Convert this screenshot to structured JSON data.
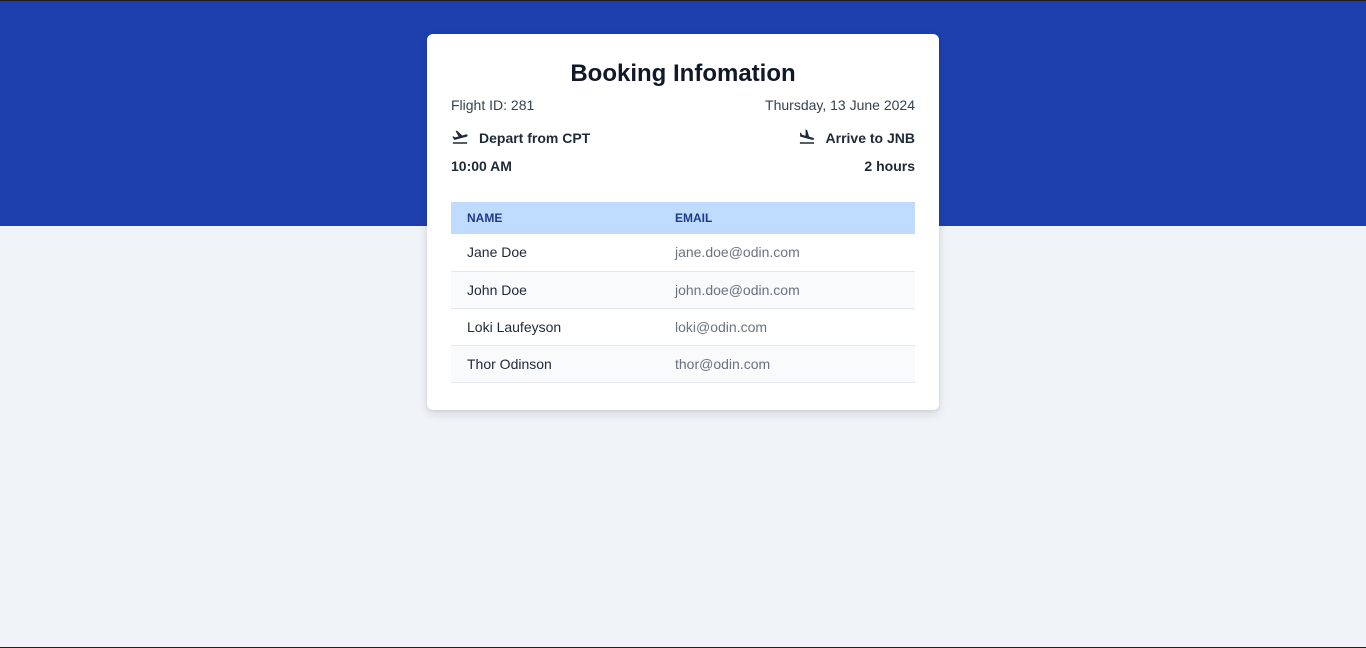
{
  "booking": {
    "title": "Booking Infomation",
    "flight_id": "Flight ID: 281",
    "date": "Thursday, 13 June 2024",
    "depart": {
      "label": "Depart from CPT",
      "icon": "flight-takeoff-icon"
    },
    "arrive": {
      "label": "Arrive to JNB",
      "icon": "flight-land-icon"
    },
    "time": "10:00 AM",
    "duration": "2 hours"
  },
  "passengers": {
    "headers": {
      "name": "NAME",
      "email": "EMAIL"
    },
    "rows": [
      {
        "name": "Jane Doe",
        "email": "jane.doe@odin.com"
      },
      {
        "name": "John Doe",
        "email": "john.doe@odin.com"
      },
      {
        "name": "Loki Laufeyson",
        "email": "loki@odin.com"
      },
      {
        "name": "Thor Odinson",
        "email": "thor@odin.com"
      }
    ]
  },
  "colors": {
    "hero": "#1e40af",
    "table_header": "#bfdbfe",
    "page_bg": "#f0f4f8"
  }
}
